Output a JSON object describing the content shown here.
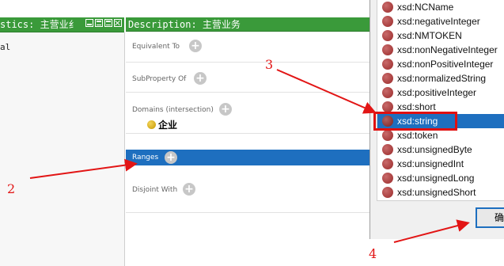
{
  "characteristics_panel": {
    "header_title": "stics: 主营业纟",
    "item": "al"
  },
  "description_panel": {
    "header_title": "Description: 主营业务",
    "sections": [
      {
        "label": "Equivalent To"
      },
      {
        "label": "SubProperty Of"
      },
      {
        "label": "Domains (intersection)"
      },
      {
        "label": "Ranges"
      },
      {
        "label": "Disjoint With"
      }
    ],
    "domain_entry": "企业",
    "plus_glyph": "+"
  },
  "datatype_list": {
    "items": [
      "xsd:NCName",
      "xsd:negativeInteger",
      "xsd:NMTOKEN",
      "xsd:nonNegativeInteger",
      "xsd:nonPositiveInteger",
      "xsd:normalizedString",
      "xsd:positiveInteger",
      "xsd:short",
      "xsd:string",
      "xsd:token",
      "xsd:unsignedByte",
      "xsd:unsignedInt",
      "xsd:unsignedLong",
      "xsd:unsignedShort"
    ],
    "selected": "xsd:string",
    "ok_button": "确"
  },
  "annotations": {
    "labels": [
      "2",
      "3",
      "4"
    ],
    "color": "#e21515"
  },
  "colors": {
    "header_green": "#3a9a3a",
    "selection_blue": "#1e6fbf",
    "datatype_dot": "#9a2a2a",
    "class_dot": "#d4a800"
  }
}
